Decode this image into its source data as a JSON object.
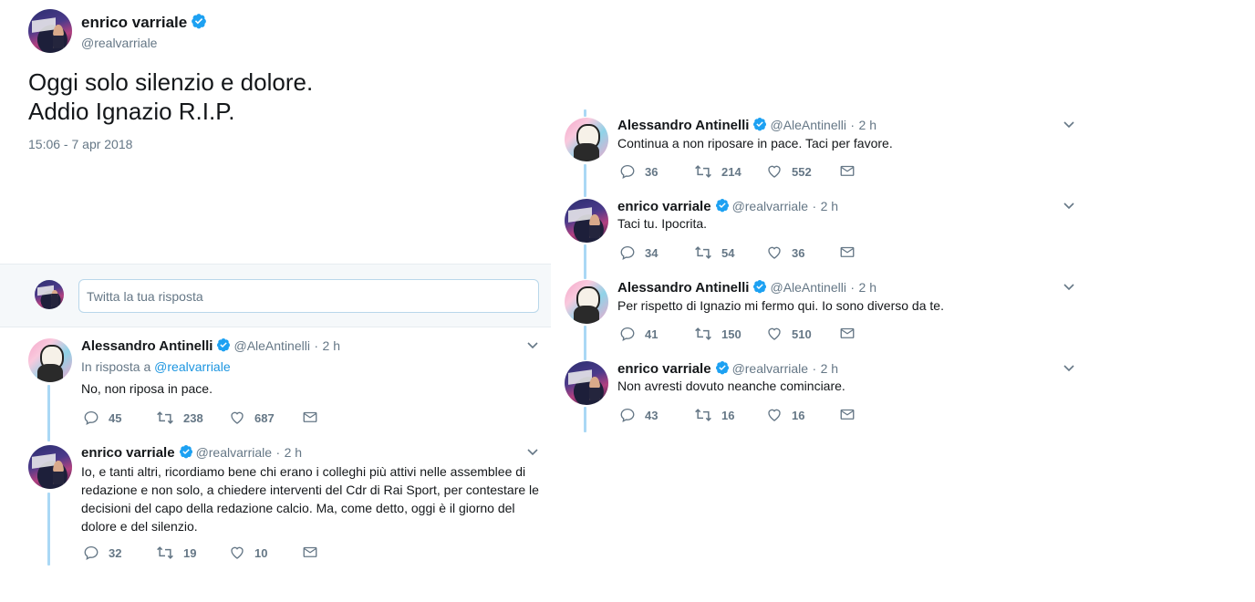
{
  "main_tweet": {
    "name": "enrico varriale",
    "handle": "@realvarriale",
    "text_line1": "Oggi solo silenzio e dolore.",
    "text_line2": "Addio Ignazio R.I.P.",
    "timestamp": "15:06 - 7 apr 2018"
  },
  "composer": {
    "placeholder": "Twitta la tua risposta"
  },
  "left_replies": [
    {
      "name": "Alessandro Antinelli",
      "handle": "@AleAntinelli",
      "dot": "·",
      "time": "2 h",
      "in_reply_prefix": "In risposta a",
      "in_reply_handle": "@realvarriale",
      "text": "No, non riposa in pace.",
      "replies": "45",
      "retweets": "238",
      "likes": "687"
    },
    {
      "name": "enrico varriale",
      "handle": "@realvarriale",
      "dot": "·",
      "time": "2 h",
      "text_lines": [
        "Io, e tanti altri, ricordiamo bene chi erano i colleghi più attivi nelle assemblee di",
        "redazione e non solo, a chiedere interventi del Cdr di Rai Sport, per contestare le",
        "decisioni del capo della redazione calcio. Ma, come detto, oggi è il giorno del",
        "dolore e del silenzio."
      ],
      "replies": "32",
      "retweets": "19",
      "likes": "10"
    }
  ],
  "right_replies": [
    {
      "name": "Alessandro Antinelli",
      "handle": "@AleAntinelli",
      "dot": "·",
      "time": "2 h",
      "text": "Continua a non riposare in pace. Taci per favore.",
      "replies": "36",
      "retweets": "214",
      "likes": "552"
    },
    {
      "name": "enrico varriale",
      "handle": "@realvarriale",
      "dot": "·",
      "time": "2 h",
      "text": "Taci tu. Ipocrita.",
      "replies": "34",
      "retweets": "54",
      "likes": "36"
    },
    {
      "name": "Alessandro Antinelli",
      "handle": "@AleAntinelli",
      "dot": "·",
      "time": "2 h",
      "text": "Per rispetto di Ignazio mi fermo qui. Io sono diverso da te.",
      "replies": "41",
      "retweets": "150",
      "likes": "510"
    },
    {
      "name": "enrico varriale",
      "handle": "@realvarriale",
      "dot": "·",
      "time": "2 h",
      "text": "Non avresti dovuto neanche cominciare.",
      "replies": "43",
      "retweets": "16",
      "likes": "16"
    }
  ],
  "icons": {
    "verified": "verified-badge-icon",
    "reply": "reply-icon",
    "retweet": "retweet-icon",
    "like": "heart-icon",
    "dm": "envelope-icon",
    "more": "chevron-down-icon"
  },
  "colors": {
    "verified": "#1da1f2",
    "link": "#1b95e0",
    "thread_line": "#aad8f5",
    "muted": "#657786",
    "composer_bg": "#f5f8fa"
  }
}
